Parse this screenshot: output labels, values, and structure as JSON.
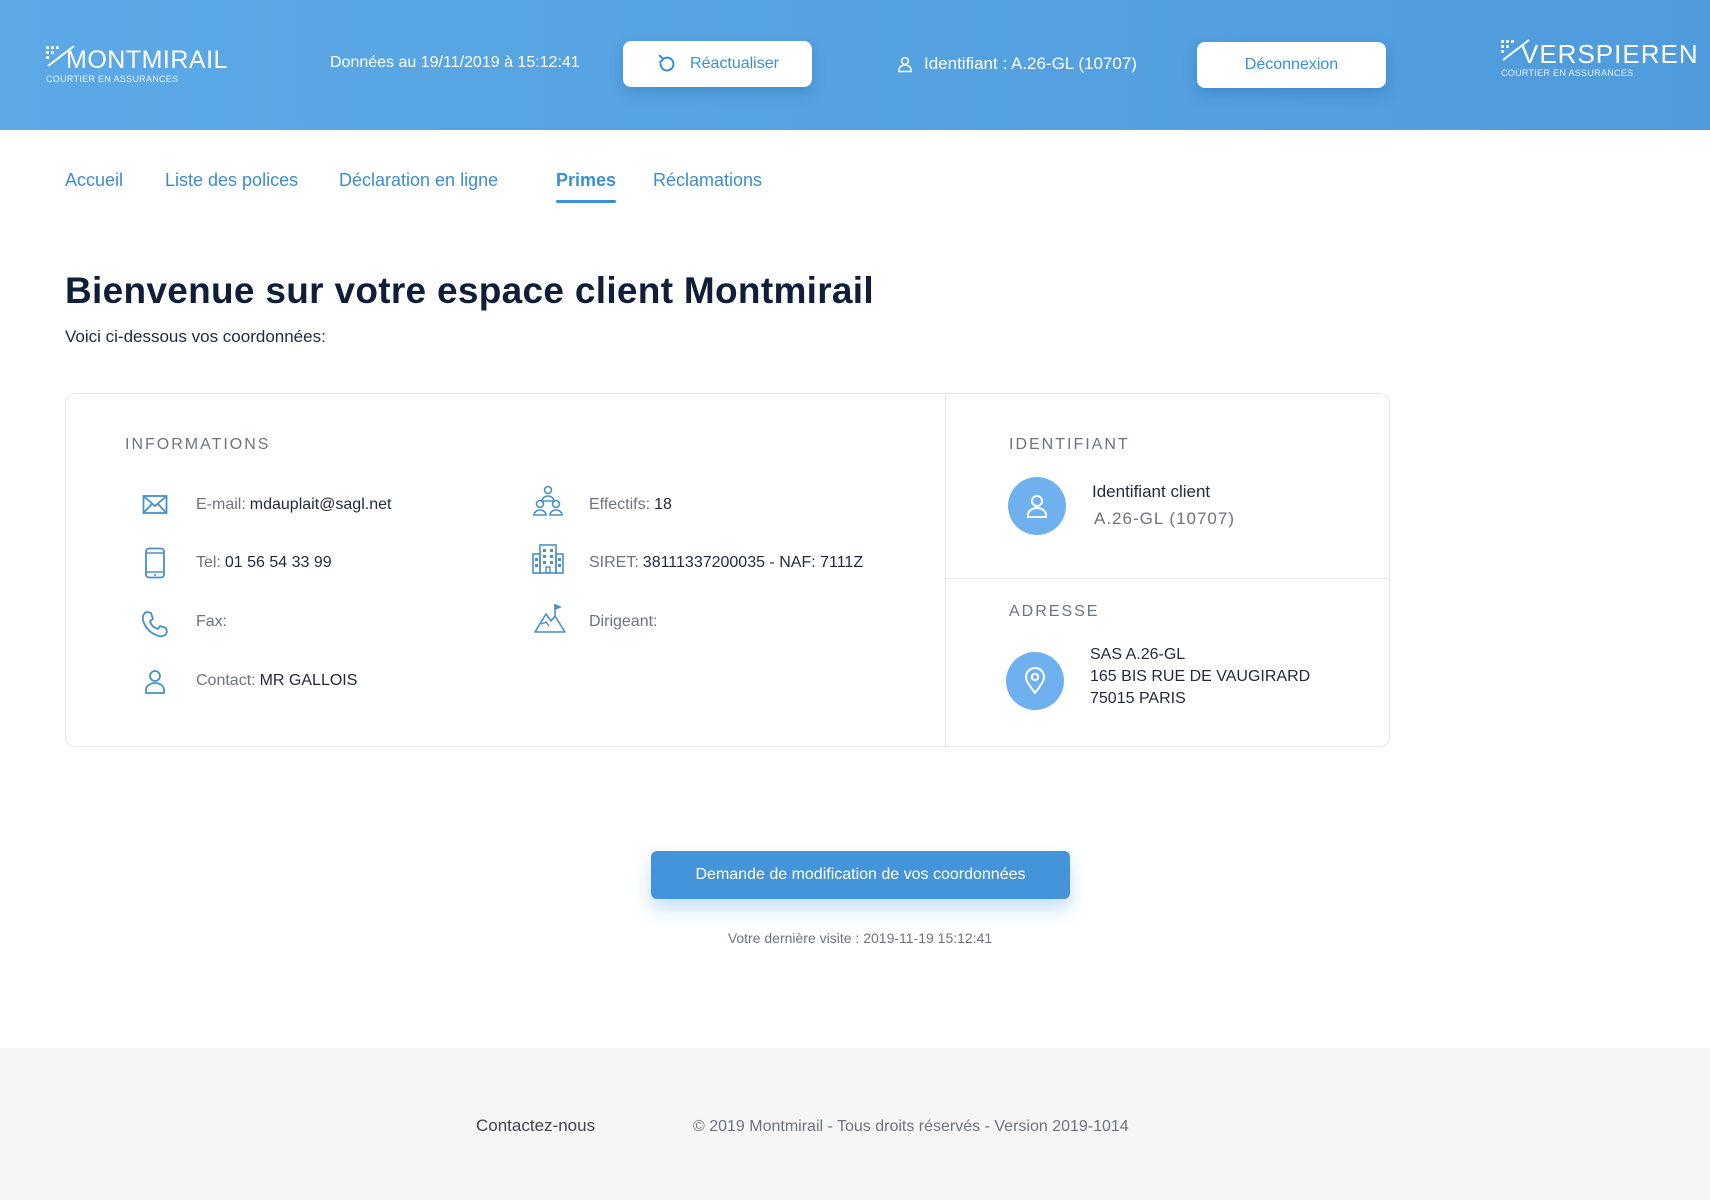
{
  "header": {
    "logo_left": {
      "brand": "MONTMIRAIL",
      "tagline": "COURTIER EN ASSURANCES"
    },
    "updated_text": "Données au 19/11/2019 à 15:12:41",
    "refresh_label": "Réactualiser",
    "identifier_text": "Identifiant :  A.26-GL (10707)",
    "logout_label": "Déconnexion",
    "logo_right": {
      "brand": "VERSPIEREN",
      "tagline": "COURTIER EN ASSURANCES"
    }
  },
  "nav": {
    "tabs": [
      {
        "label": "Accueil",
        "active": false
      },
      {
        "label": "Liste des polices",
        "active": false
      },
      {
        "label": "Déclaration en ligne",
        "active": false
      },
      {
        "label": "Primes",
        "active": true
      },
      {
        "label": "Réclamations",
        "active": false
      }
    ]
  },
  "main": {
    "title": "Bienvenue sur votre espace client Montmirail",
    "subtitle": "Voici ci-dessous vos coordonnées:"
  },
  "info": {
    "section_title": "INFORMATIONS",
    "email": {
      "label": "E-mail:",
      "value": "mdauplait@sagl.net",
      "icon": "envelope-icon"
    },
    "tel": {
      "label": "Tel:",
      "value": "01 56 54 33 99",
      "icon": "mobile-phone-icon"
    },
    "fax": {
      "label": "Fax:",
      "value": "",
      "icon": "phone-icon"
    },
    "contact": {
      "label": "Contact:",
      "value": "MR GALLOIS",
      "icon": "user-icon"
    },
    "effectifs": {
      "label": "Effectifs:",
      "value": "18",
      "icon": "people-group-icon"
    },
    "siret": {
      "label": "SIRET:",
      "value": "38111337200035 - NAF: 7111Z",
      "icon": "building-icon"
    },
    "dirigeant": {
      "label": "Dirigeant:",
      "value": "",
      "icon": "mountain-flag-icon"
    }
  },
  "identifiant": {
    "section_title": "IDENTIFIANT",
    "label": "Identifiant client",
    "value": "A.26-GL (10707)"
  },
  "adresse": {
    "section_title": "ADRESSE",
    "line1": "SAS A.26-GL",
    "line2": "165 BIS RUE DE VAUGIRARD",
    "line3": "75015 PARIS"
  },
  "actions": {
    "modify_label": "Demande de modification de vos coordonnées",
    "last_visit": "Votre dernière visite : 2019-11-19 15:12:41"
  },
  "footer": {
    "contact_label": "Contactez-nous",
    "copyright": "© 2019 Montmirail - Tous droits réservés - Version 2019-1014"
  },
  "colors": {
    "header_blue": "#5ca9e6",
    "accent": "#3b8fd6",
    "icon_blue": "#4a90c8",
    "circle_blue": "#6fb0ee"
  }
}
